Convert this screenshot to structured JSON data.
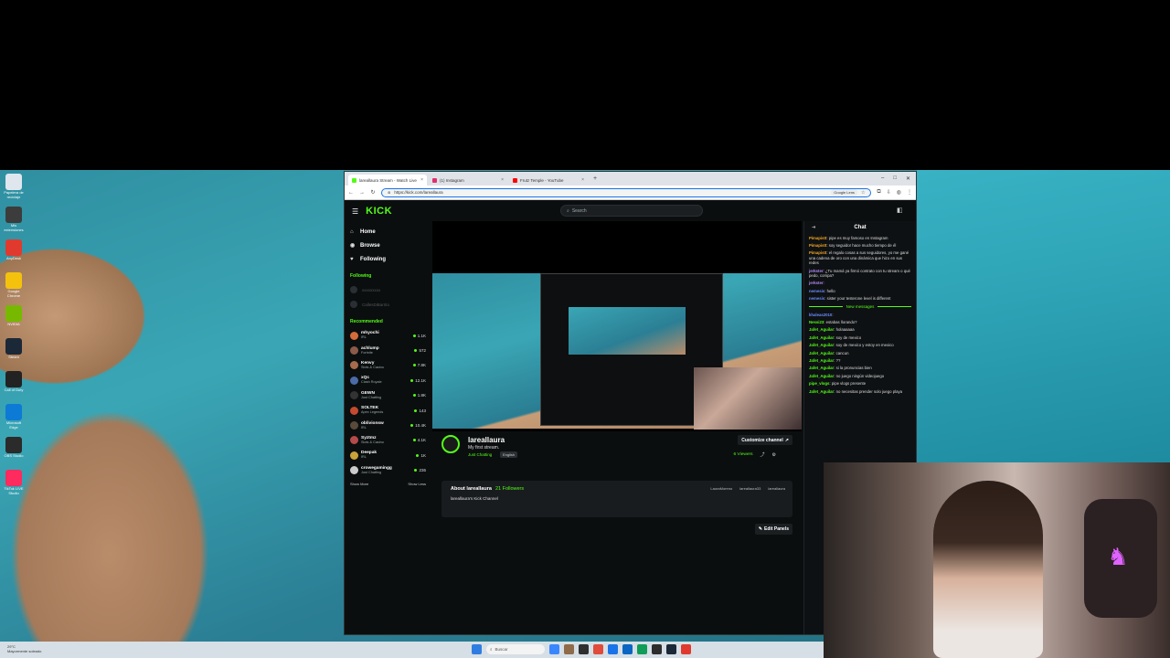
{
  "desktop": {
    "icons": [
      {
        "label": "Papelera de reciclaje",
        "color": "#dfe6ee"
      },
      {
        "label": "Mis extensiones",
        "color": "#3c3c3c"
      },
      {
        "label": "AnyDesk",
        "color": "#e03a2f"
      },
      {
        "label": "Google Chrome",
        "color": "#f4c20d"
      },
      {
        "label": "NVIDIA",
        "color": "#76b900"
      },
      {
        "label": "Steam",
        "color": "#1b2838"
      },
      {
        "label": "Call of Duty",
        "color": "#222222"
      },
      {
        "label": "Microsoft Edge",
        "color": "#0d7ad6"
      },
      {
        "label": "OBS Studio",
        "color": "#2b2b2b"
      },
      {
        "label": "TikTok LIVE Studio",
        "color": "#ff2b5e"
      }
    ]
  },
  "browser": {
    "tabs": [
      {
        "title": "lareallaura Stream - Watch Live",
        "fav_color": "#53fc18",
        "active": true
      },
      {
        "title": "(1) Instagram",
        "fav_color": "#e1306c",
        "active": false
      },
      {
        "title": "Frutz Temple - YouTube",
        "fav_color": "#ff0000",
        "active": false
      }
    ],
    "url": "https://kick.com/lareallaura",
    "lens": "Google Lens"
  },
  "kick": {
    "logo": "KICK",
    "search_placeholder": "Search",
    "nav": [
      {
        "label": "Home",
        "icon": "⌂"
      },
      {
        "label": "Browse",
        "icon": "◉"
      },
      {
        "label": "Following",
        "icon": "♥"
      }
    ],
    "following_heading": "Following",
    "following": [
      "xxxxxxxxx",
      "CallesDiBarrito"
    ],
    "recommended_heading": "Recommended",
    "recommended": [
      {
        "name": "mhyochi",
        "cat": "IRL",
        "count": "1.1K",
        "color": "#d36b3b"
      },
      {
        "name": "achlump",
        "cat": "Fortnite",
        "count": "572",
        "color": "#8a5a4a"
      },
      {
        "name": "Kenvy",
        "cat": "Slots & Casino",
        "count": "7.8K",
        "color": "#a86b4c"
      },
      {
        "name": "xQc",
        "cat": "Clash Royale",
        "count": "12.1K",
        "color": "#4b6aa8"
      },
      {
        "name": "GEWN",
        "cat": "Just Chatting",
        "count": "1.8K",
        "color": "#333333"
      },
      {
        "name": "SOLTEK",
        "cat": "Apex Legends",
        "count": "143",
        "color": "#c44a2f"
      },
      {
        "name": "oblivionsw",
        "cat": "IRL",
        "count": "10.4K",
        "color": "#5a4a3a"
      },
      {
        "name": "Syztmz",
        "cat": "Slots & Casino",
        "count": "4.1K",
        "color": "#b44a4a"
      },
      {
        "name": "Deepak",
        "cat": "IRL",
        "count": "1K",
        "color": "#c9a23a"
      },
      {
        "name": "crowegamingg",
        "cat": "Just Chatting",
        "count": "236",
        "color": "#cccccc"
      }
    ],
    "show_more": "Show More",
    "show_less": "Show Less",
    "channel": {
      "name": "lareallaura",
      "title": "My first stream.",
      "category": "Just Chatting",
      "language": "English",
      "customize": "Customize channel",
      "viewers": "6 Viewers"
    },
    "about": {
      "heading": "About lareallaura",
      "followers": "21 Followers",
      "description": "lareallaura's Kick Channel",
      "socials": [
        "LauraMoreno",
        "lareallaura33",
        "lareallaura"
      ]
    },
    "edit_panels": "Edit Panels",
    "chat": {
      "heading": "Chat",
      "new_messages": "New messages",
      "messages": [
        {
          "user": "Pimapistt",
          "text": "pipe es muy famoso en Instagram",
          "color": "#f5a623"
        },
        {
          "user": "Pimapistt",
          "text": "soy seguidor hace mucho tiempo de él",
          "color": "#f5a623"
        },
        {
          "user": "Pimapistt",
          "text": "el regalo cosas a sus seguidores, yo me gané una cadena de oro con una dinámica que hizo en sus redes",
          "color": "#f5a623"
        },
        {
          "user": "jerkster",
          "text": "¿Tu mamá ya firmó contrato con tu stream o qué pedo, compa?",
          "color": "#b58cff"
        },
        {
          "user": "jerkster",
          "text": "",
          "color": "#b58cff"
        },
        {
          "user": "nemesis",
          "text": "hello",
          "color": "#6b8cff"
        },
        {
          "user": "nemesis",
          "text": "sister your testerone level is different",
          "color": "#6b8cff"
        },
        {
          "user": "khaleas2010",
          "text": "",
          "color": "#6b8cff"
        },
        {
          "user": "Nessi23",
          "text": "estabas llorando?",
          "color": "#53fc18"
        },
        {
          "user": "Jafet_Aguilar",
          "text": "holaaaaaa",
          "color": "#53fc18"
        },
        {
          "user": "Jafet_Aguilar",
          "text": "soy de mexico",
          "color": "#53fc18"
        },
        {
          "user": "Jafet_Aguilar",
          "text": "soy de mexico y estoy en mexico",
          "color": "#53fc18"
        },
        {
          "user": "Jafet_Aguilar",
          "text": "cancun",
          "color": "#53fc18"
        },
        {
          "user": "Jafet_Aguilar",
          "text": "??",
          "color": "#53fc18"
        },
        {
          "user": "Jafet_Aguilar",
          "text": "si la pronuncias bien",
          "color": "#53fc18"
        },
        {
          "user": "Jafet_Aguilar",
          "text": "no juego ningún videojuego",
          "color": "#53fc18"
        },
        {
          "user": "pipe_vlogs",
          "text": "pipe vlogs presente",
          "color": "#53fc18"
        },
        {
          "user": "Jafet_Aguilar",
          "text": "no necesitas prender solo juego playa",
          "color": "#53fc18"
        }
      ]
    }
  },
  "taskbar": {
    "weather": "29°C",
    "weather_desc": "Mayormente soleado",
    "search_placeholder": "Buscar",
    "apps": [
      "#3a86ff",
      "#8f6b4a",
      "#2f2f2f",
      "#e04b3b",
      "#1a73e8",
      "#0a66c2",
      "#0f9d58",
      "#2d2d2d",
      "#1b2838",
      "#e03a2f"
    ]
  }
}
